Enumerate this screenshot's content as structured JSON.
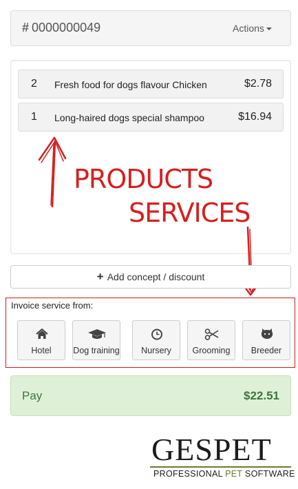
{
  "header": {
    "hash_symbol": "#",
    "order_number": "0000000049",
    "actions_label": "Actions"
  },
  "line_items": [
    {
      "qty": "2",
      "description": "Fresh food for dogs flavour Chicken",
      "price": "$2.78"
    },
    {
      "qty": "1",
      "description": "Long-haired dogs special shampoo",
      "price": "$16.94"
    }
  ],
  "annotations": {
    "products": "PRODUCTS",
    "services": "SERVICES"
  },
  "add_concept": {
    "plus": "+",
    "label": "Add concept / discount"
  },
  "invoice_services": {
    "label": "Invoice service from:",
    "services": [
      {
        "label": "Hotel",
        "icon": "home-icon"
      },
      {
        "label": "Dog training",
        "icon": "graduation-cap-icon"
      },
      {
        "label": "Nursery",
        "icon": "clock-icon"
      },
      {
        "label": "Grooming",
        "icon": "scissors-icon"
      },
      {
        "label": "Breeder",
        "icon": "github-cat-icon"
      }
    ]
  },
  "pay": {
    "label": "Pay",
    "total": "$22.51"
  },
  "brand": {
    "name_part1": "GES",
    "name_part2": "PET",
    "tagline_part1": "PROFESSIONAL ",
    "tagline_accent": "PET",
    "tagline_part3": " SOFTWARE"
  },
  "colors": {
    "annotation_red": "#d42020",
    "pay_green_bg": "#dff0d8",
    "pay_green_text": "#3c763d",
    "brand_olive": "#6b7a28"
  }
}
